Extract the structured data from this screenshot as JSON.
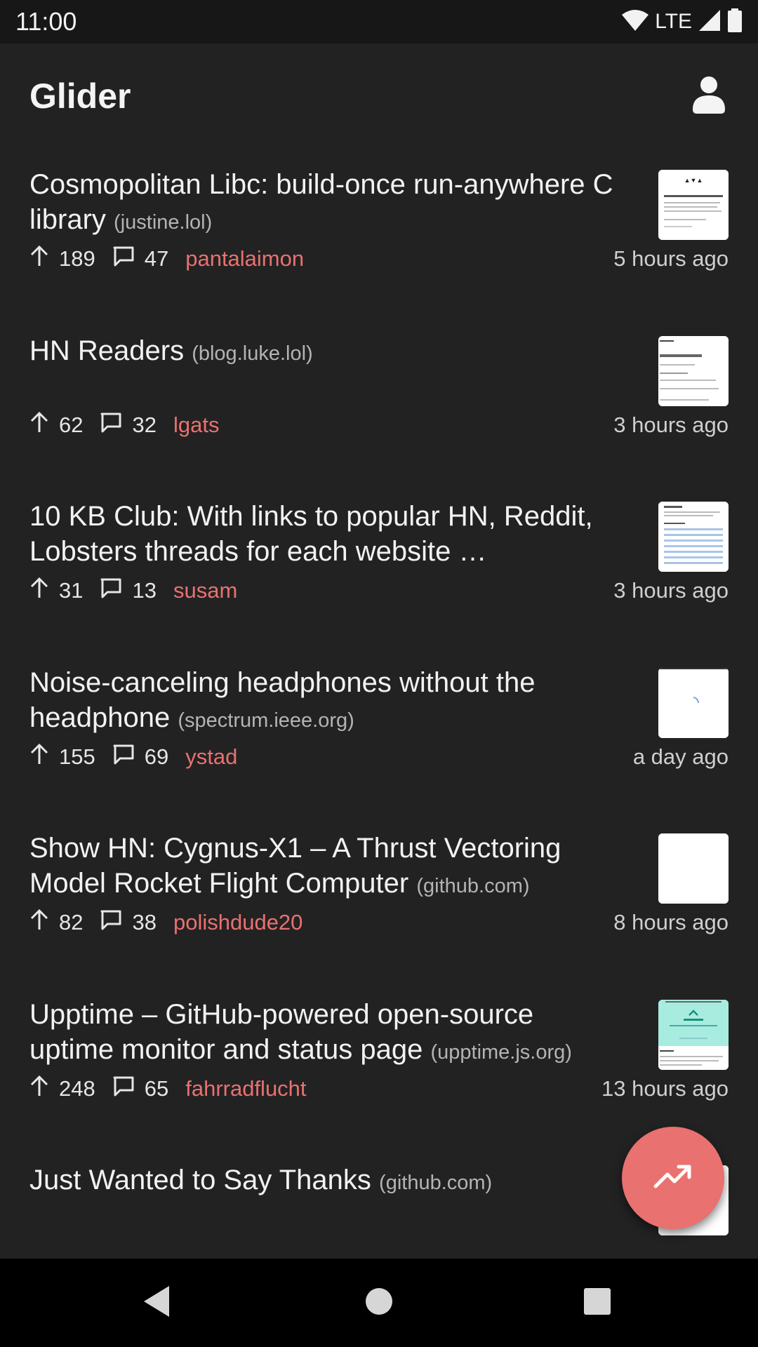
{
  "status_bar": {
    "time": "11:00",
    "network": "LTE",
    "icons": [
      "wifi-icon",
      "signal-icon",
      "battery-icon"
    ]
  },
  "app_bar": {
    "title": "Glider",
    "account_icon": "account-icon"
  },
  "colors": {
    "background": "#222223",
    "accent": "#e9716f",
    "text": "#f2f2f2",
    "muted": "#b4b4b4"
  },
  "stories": [
    {
      "title": "Cosmopolitan Libc: build-once run-anywhere C library",
      "domain": "(justine.lol)",
      "points": "189",
      "comments": "47",
      "user": "pantalaimon",
      "time": "5 hours ago",
      "thumb": "page"
    },
    {
      "title": "HN Readers",
      "domain": "(blog.luke.lol)",
      "points": "62",
      "comments": "32",
      "user": "lgats",
      "time": "3 hours ago",
      "thumb": "page"
    },
    {
      "title": "10 KB Club: With links to popular HN, Reddit, Lobsters threads for each website …",
      "domain": "",
      "points": "31",
      "comments": "13",
      "user": "susam",
      "time": "3 hours ago",
      "thumb": "table"
    },
    {
      "title": "Noise-canceling headphones without the headphone",
      "domain": "(spectrum.ieee.org)",
      "points": "155",
      "comments": "69",
      "user": "ystad",
      "time": "a day ago",
      "thumb": "loading"
    },
    {
      "title": "Show HN: Cygnus-X1 – A Thrust Vectoring Model Rocket Flight Computer",
      "domain": "(github.com)",
      "points": "82",
      "comments": "38",
      "user": "polishdude20",
      "time": "8 hours ago",
      "thumb": "blank"
    },
    {
      "title": "Upptime – GitHub-powered open-source uptime monitor and status page",
      "domain": "(upptime.js.org)",
      "points": "248",
      "comments": "65",
      "user": "fahrradflucht",
      "time": "13 hours ago",
      "thumb": "upptime"
    },
    {
      "title": "Just Wanted to Say Thanks",
      "domain": "(github.com)",
      "points": "",
      "comments": "",
      "user": "",
      "time": "",
      "thumb": "page"
    }
  ],
  "fab": {
    "icon": "trending-up-icon"
  },
  "nav_bar": {
    "icons": [
      "back-icon",
      "home-icon",
      "recents-icon"
    ]
  }
}
